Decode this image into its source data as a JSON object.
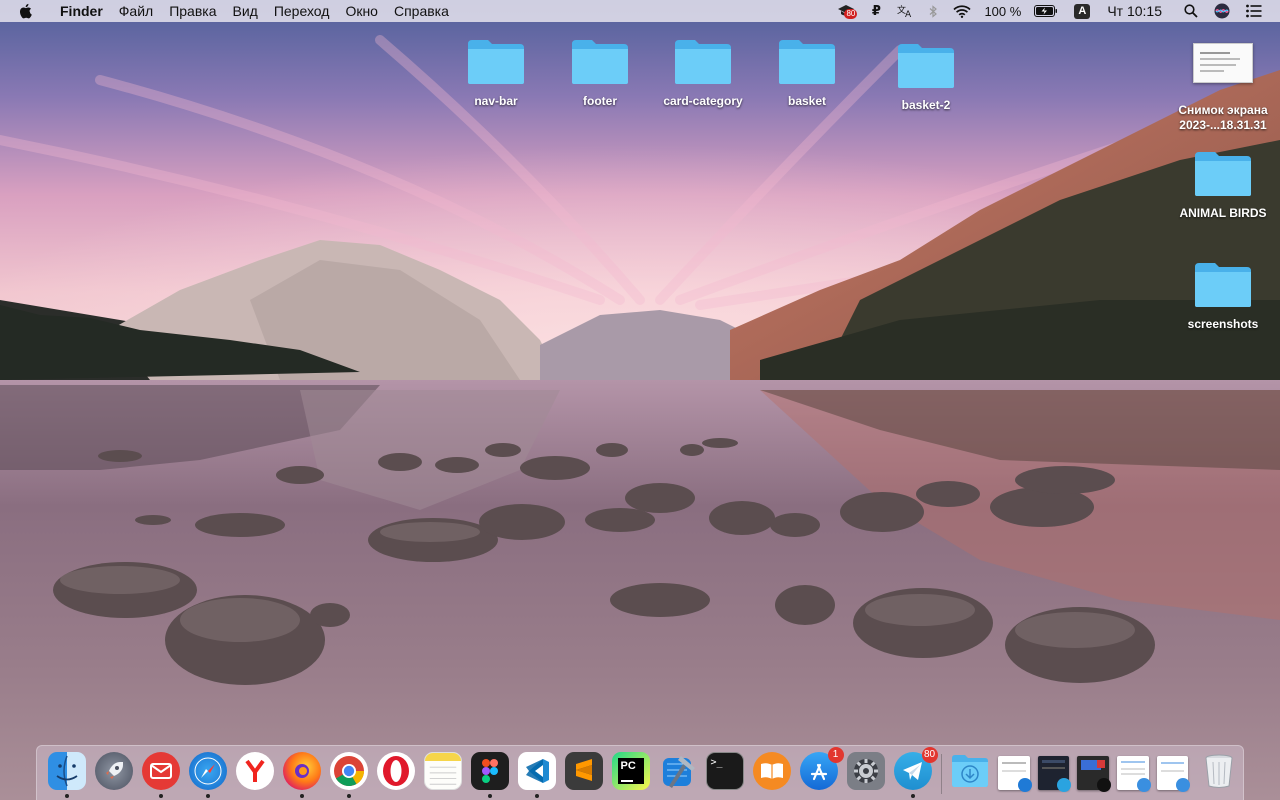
{
  "menubar": {
    "app_name": "Finder",
    "items": [
      "Файл",
      "Правка",
      "Вид",
      "Переход",
      "Окно",
      "Справка"
    ],
    "status": {
      "notif_badge": "80",
      "battery": "100 %",
      "input_source": "A",
      "clock": "Чт 10:15"
    }
  },
  "desktop": {
    "top_folders": [
      {
        "label": "nav-bar"
      },
      {
        "label": "footer"
      },
      {
        "label": "card-category"
      },
      {
        "label": "basket"
      },
      {
        "label": "basket-2"
      }
    ],
    "right_column": [
      {
        "label_line1": "Снимок экрана",
        "label_line2": "2023-...18.31.31",
        "kind": "screenshot"
      },
      {
        "label": "ANIMAL BIRDS",
        "kind": "folder"
      },
      {
        "label": "screenshots",
        "kind": "folder"
      }
    ]
  },
  "dock": {
    "apps": [
      {
        "name": "Finder",
        "running": true
      },
      {
        "name": "Launchpad",
        "running": false
      },
      {
        "name": "Mail",
        "running": true
      },
      {
        "name": "Safari",
        "running": true
      },
      {
        "name": "Yandex Browser",
        "running": false
      },
      {
        "name": "Firefox",
        "running": true
      },
      {
        "name": "Chrome",
        "running": true
      },
      {
        "name": "Opera",
        "running": false
      },
      {
        "name": "Notes",
        "running": false
      },
      {
        "name": "Figma",
        "running": true
      },
      {
        "name": "VS Code",
        "running": true
      },
      {
        "name": "Sublime Text",
        "running": false
      },
      {
        "name": "PyCharm",
        "running": false
      },
      {
        "name": "Xcode",
        "running": false
      },
      {
        "name": "Terminal",
        "running": false
      },
      {
        "name": "Books",
        "running": false
      },
      {
        "name": "App Store",
        "running": false,
        "badge": "1"
      },
      {
        "name": "System Preferences",
        "running": false
      },
      {
        "name": "Telegram",
        "running": true,
        "badge": "80"
      }
    ],
    "colors": {
      "folder_blue": "#5ec4f5",
      "badge_red": "#e2362f"
    }
  }
}
